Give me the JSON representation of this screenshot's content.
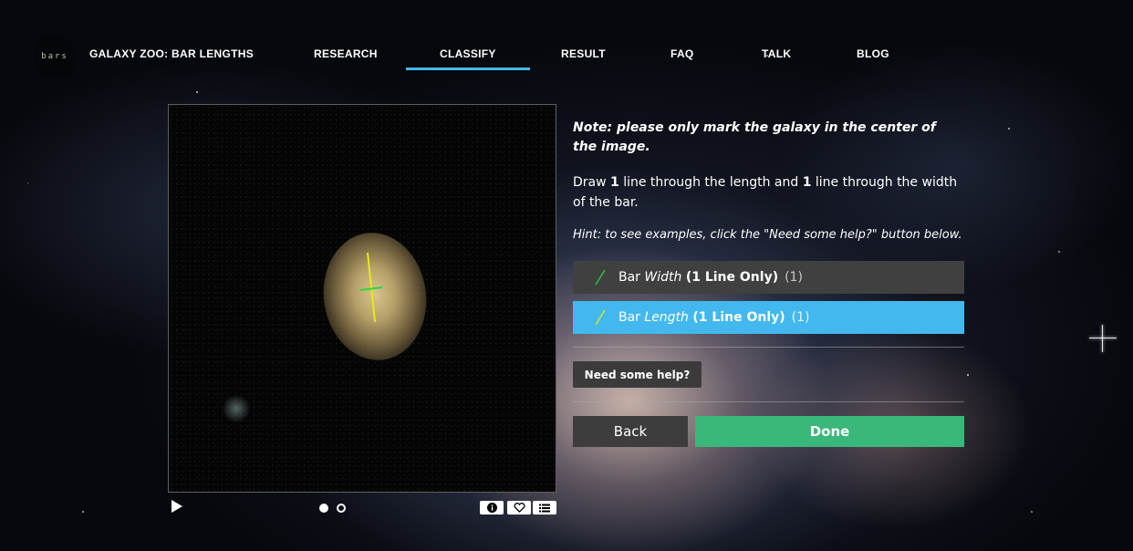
{
  "header": {
    "logo_text": "bars",
    "site_title": "GALAXY ZOO: BAR LENGTHS",
    "nav": [
      {
        "label": "RESEARCH",
        "active": false
      },
      {
        "label": "CLASSIFY",
        "active": true
      },
      {
        "label": "RESULT",
        "active": false
      },
      {
        "label": "FAQ",
        "active": false
      },
      {
        "label": "TALK",
        "active": false
      },
      {
        "label": "BLOG",
        "active": false
      }
    ]
  },
  "viewer": {
    "frames_total": 2,
    "current_frame": 1,
    "marks": [
      {
        "tool": "Bar Length",
        "color": "#e8e81a"
      },
      {
        "tool": "Bar Width",
        "color": "#27d83a"
      }
    ],
    "controls": {
      "play_icon": "play-icon",
      "info_icon": "info-icon",
      "favorite_icon": "heart-icon",
      "collections_icon": "list-icon"
    }
  },
  "task": {
    "note": "Note: please only mark the galaxy in the center of the image.",
    "instruction": {
      "part1": "Draw ",
      "num1": "1",
      "part2": " line through the length and ",
      "num2": "1",
      "part3": " line through the width of the bar."
    },
    "hint": "Hint: to see examples, click the \"Need some help?\" button below.",
    "tools": [
      {
        "prefix": "Bar ",
        "italic": "Width",
        "bold": "(1 Line Only)",
        "count": "(1)",
        "active": false,
        "icon_color": "#27d83a"
      },
      {
        "prefix": "Bar ",
        "italic": "Length",
        "bold": "(1 Line Only)",
        "count": "(1)",
        "active": true,
        "icon_color": "#e8e81a"
      }
    ],
    "help_label": "Need some help?",
    "back_label": "Back",
    "done_label": "Done"
  },
  "colors": {
    "accent": "#45b8e8",
    "active_tool": "#43b8ee",
    "done": "#3ab77a",
    "panel_dark": "#404040"
  }
}
